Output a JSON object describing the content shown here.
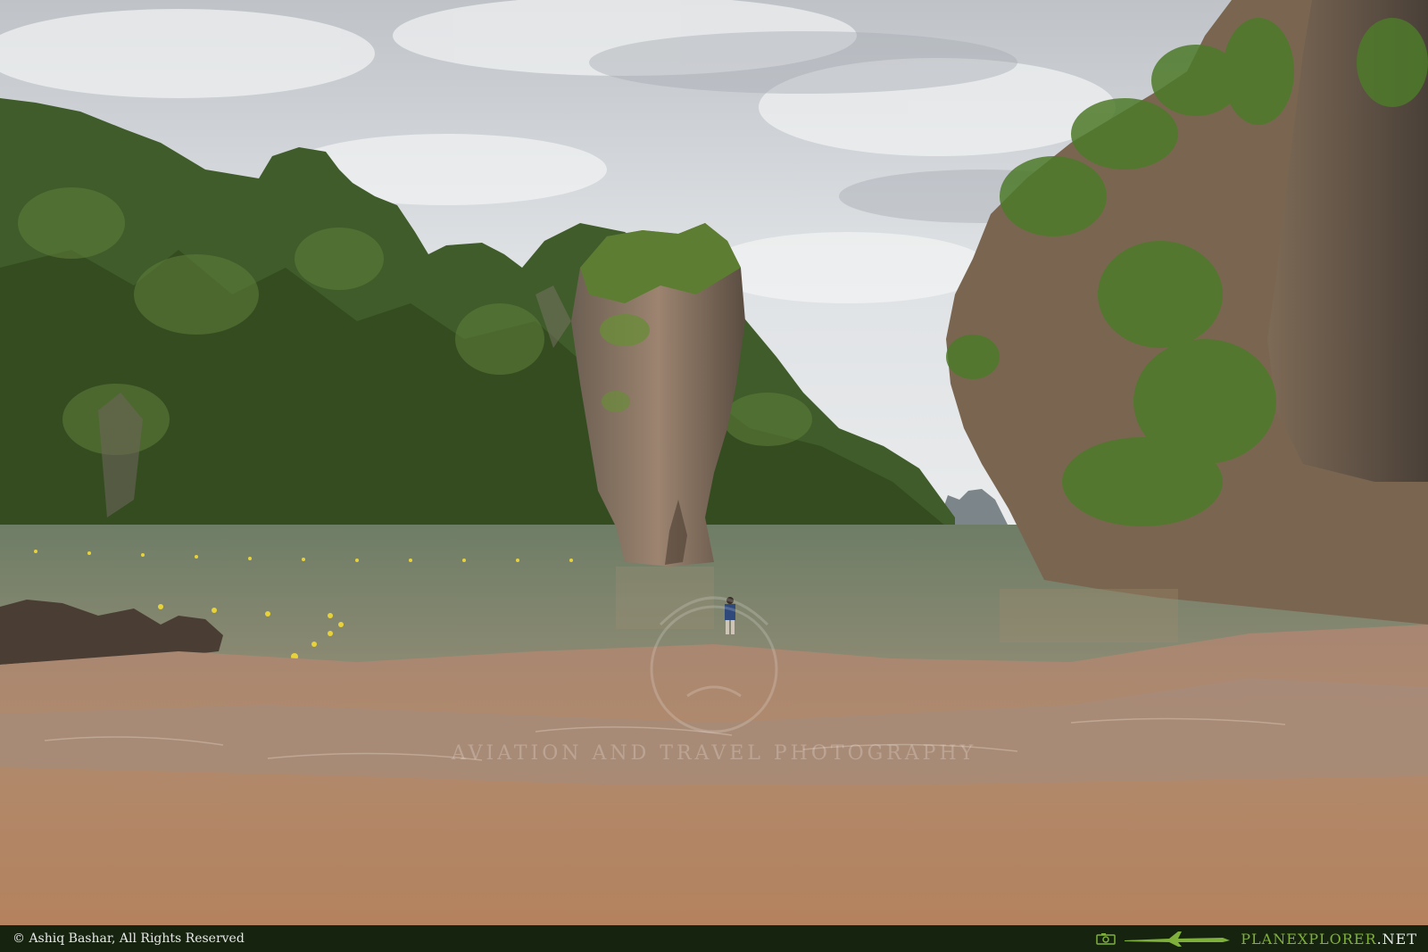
{
  "photo": {
    "watermark": "AVIATION AND TRAVEL PHOTOGRAPHY"
  },
  "footer": {
    "copyright": "© Ashiq Bashar, All Rights Reserved",
    "brand_main": "PLANEXPLORER",
    "brand_tld": ".NET",
    "icons": [
      "camera-icon",
      "plane-icon"
    ]
  },
  "colors": {
    "footer_bg": "#16240f",
    "brand_green": "#7fb03c",
    "sky": "#d9dde0",
    "water": "#6d7d63",
    "sand": "#b08366",
    "foliage": "#3c5a26"
  }
}
